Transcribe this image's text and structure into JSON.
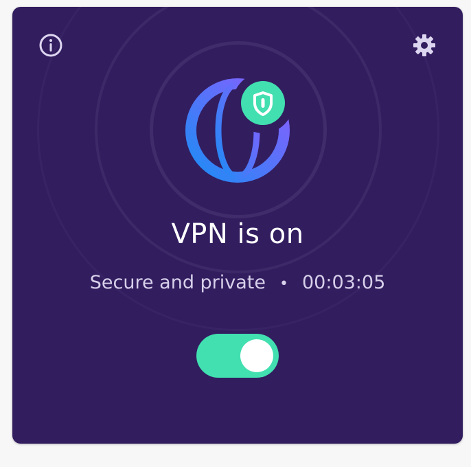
{
  "vpn": {
    "title": "VPN is on",
    "status": "Secure and private",
    "separator": "•",
    "timer": "00:03:05",
    "toggle_on": true
  },
  "icons": {
    "info": "info-icon",
    "settings": "gear-icon",
    "globe": "globe-icon",
    "shield": "shield-icon"
  },
  "colors": {
    "card_background": "#321d5f",
    "accent_green": "#42dfb0",
    "globe_gradient_start": "#1d8cf4",
    "globe_gradient_end": "#8d5cff",
    "text_primary": "#ffffff",
    "text_secondary": "#d7d0ea"
  }
}
